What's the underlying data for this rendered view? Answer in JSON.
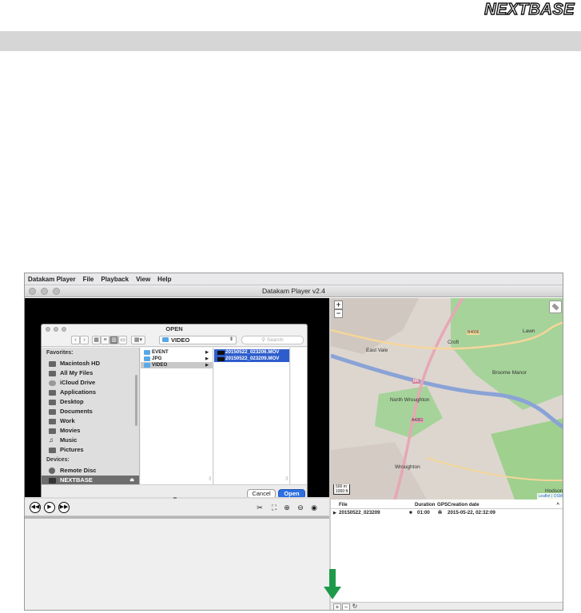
{
  "page": {
    "logo_text": "NEXTBASE"
  },
  "app": {
    "menu": [
      "Datakam Player",
      "File",
      "Playback",
      "View",
      "Help"
    ],
    "window_title": "Datakam Player v2.4"
  },
  "dialog": {
    "title": "OPEN",
    "current_folder": "VIDEO",
    "search_placeholder": "Search",
    "sidebar": {
      "favorites_heading": "Favorites:",
      "favorites": [
        {
          "label": "Macintosh HD",
          "icon": "hard-drive-icon"
        },
        {
          "label": "All My Files",
          "icon": "files-icon"
        },
        {
          "label": "iCloud Drive",
          "icon": "cloud-icon"
        },
        {
          "label": "Applications",
          "icon": "applications-icon"
        },
        {
          "label": "Desktop",
          "icon": "desktop-icon"
        },
        {
          "label": "Documents",
          "icon": "documents-icon"
        },
        {
          "label": "Work",
          "icon": "folder-icon"
        },
        {
          "label": "Movies",
          "icon": "movies-icon"
        },
        {
          "label": "Music",
          "icon": "music-icon"
        },
        {
          "label": "Pictures",
          "icon": "pictures-icon"
        }
      ],
      "devices_heading": "Devices:",
      "devices": [
        {
          "label": "Remote Disc",
          "icon": "disc-icon"
        },
        {
          "label": "NEXTBASE",
          "icon": "drive-icon",
          "selected": true
        }
      ]
    },
    "folders": [
      "EVENT",
      "JPG",
      "VIDEO"
    ],
    "selected_folder_index": 2,
    "files": [
      "20150522_023206.MOV",
      "20150522_023209.MOV"
    ],
    "cancel_label": "Cancel",
    "open_label": "Open"
  },
  "map": {
    "labels": [
      "East Vale",
      "Broome Manor",
      "North Wroughton",
      "Wroughton",
      "Croft",
      "Lawn",
      "Hodson"
    ],
    "roads": [
      "M4",
      "B4006",
      "A4361"
    ],
    "scale_top": "500 m",
    "scale_bottom": "1000 ft",
    "attribution": "Leaflet | OSM",
    "colors": {
      "motorway": "#8aa3d6",
      "primary": "#e7a7b5",
      "park": "#a6d39a",
      "urban": "#d9d2cc"
    }
  },
  "filelist": {
    "headers": {
      "file": "File",
      "duration": "Duration",
      "gps": "GPS",
      "created": "Creation date"
    },
    "rows": [
      {
        "file": "20150522_023209",
        "duration": "01:00",
        "created": "2015-05-22, 02:32:09"
      }
    ],
    "add_label": "+",
    "remove_label": "−",
    "refresh_label": "↻"
  },
  "arrow_color": "#1e9a4a"
}
